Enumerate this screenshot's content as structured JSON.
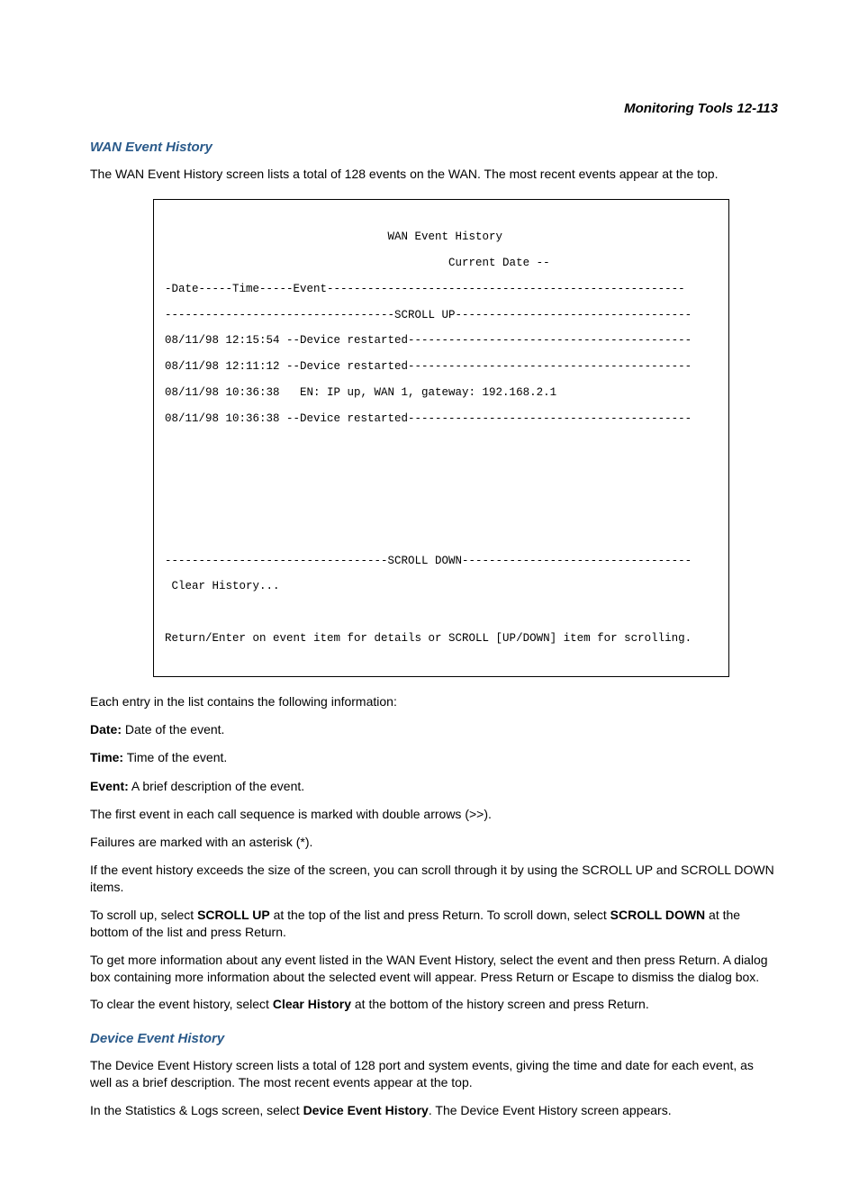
{
  "header": {
    "breadcrumb": "Monitoring Tools   12-113"
  },
  "section1": {
    "heading": "WAN Event History",
    "p1": "The WAN Event History screen lists a total of 128 events on the WAN. The most recent events appear at the top."
  },
  "terminal": {
    "line1": "                                 WAN Event History",
    "line2": "                                          Current Date --",
    "line3": "-Date-----Time-----Event-----------------------------------------------------",
    "line4": "----------------------------------SCROLL UP-----------------------------------",
    "line5": "08/11/98 12:15:54 --Device restarted------------------------------------------",
    "line6": "08/11/98 12:11:12 --Device restarted------------------------------------------",
    "line7": "08/11/98 10:36:38   EN: IP up, WAN 1, gateway: 192.168.2.1",
    "line8": "08/11/98 10:36:38 --Device restarted------------------------------------------",
    "line_blank": "",
    "line9": "---------------------------------SCROLL DOWN----------------------------------",
    "line10": " Clear History...",
    "line11": "Return/Enter on event item for details or SCROLL [UP/DOWN] item for scrolling."
  },
  "body": {
    "p2": "Each entry in the list contains the following information:",
    "date_label": "Date:",
    "date_text": " Date of the event.",
    "time_label": "Time:",
    "time_text": " Time of the event.",
    "event_label": "Event:",
    "event_text": " A brief description of the event.",
    "p3": "The first event in each call sequence is marked with double arrows (>>).",
    "p4": "Failures are marked with an asterisk (*).",
    "p5": "If the event history exceeds the size of the screen, you can scroll through it by using the SCROLL UP and SCROLL DOWN items.",
    "p6a": "To scroll up, select ",
    "p6b": "SCROLL UP",
    "p6c": " at the top of the list and press Return. To scroll down, select ",
    "p6d": "SCROLL DOWN",
    "p6e": " at the bottom of the list and press Return.",
    "p7": "To get more information about any event listed in the WAN Event History, select the event and then press Return. A dialog box containing more information about the selected event will appear. Press Return or Escape to dismiss the dialog box.",
    "p8a": "To clear the event history, select ",
    "p8b": "Clear History",
    "p8c": " at the bottom of the history screen and press Return."
  },
  "section2": {
    "heading": "Device Event History",
    "p1": "The Device Event History screen lists a total of 128 port and system events, giving the time and date for each event, as well as a brief description. The most recent events appear at the top.",
    "p2a": "In the Statistics & Logs screen, select ",
    "p2b": "Device Event History",
    "p2c": ". The Device Event History screen appears."
  }
}
